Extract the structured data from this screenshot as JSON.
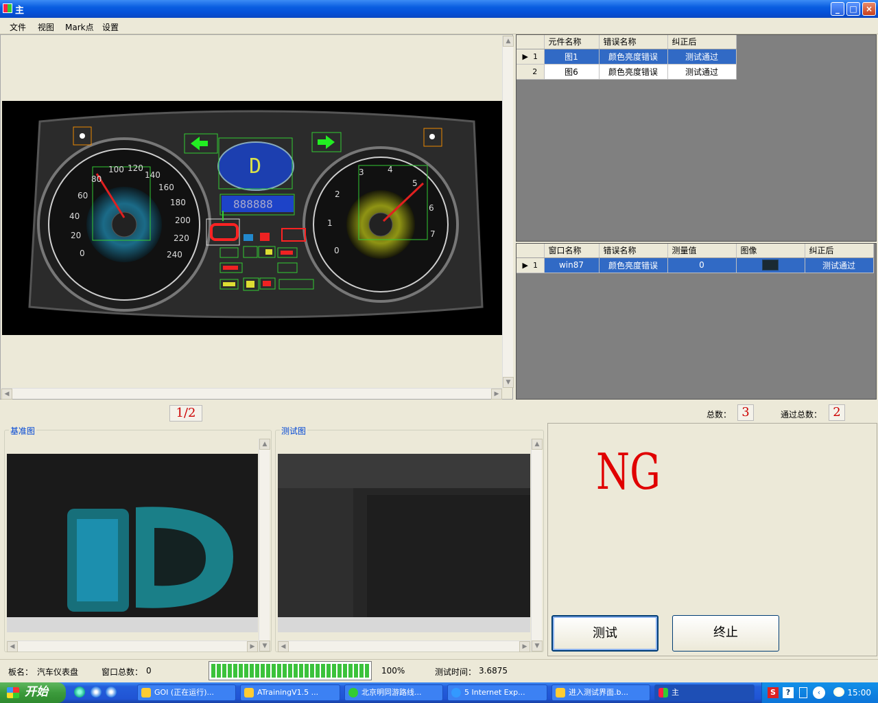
{
  "window": {
    "title": "主"
  },
  "menu": [
    "文件",
    "视图",
    "Mark点",
    "设置"
  ],
  "components_grid": {
    "columns": [
      "元件名称",
      "错误名称",
      "纠正后"
    ],
    "rows": [
      {
        "index": "1",
        "name": "图1",
        "error": "颜色亮度错误",
        "corrected": "测试通过"
      },
      {
        "index": "2",
        "name": "图6",
        "error": "颜色亮度错误",
        "corrected": "测试通过"
      }
    ]
  },
  "windows_grid": {
    "columns": [
      "窗口名称",
      "错误名称",
      "测量值",
      "图像",
      "纠正后"
    ],
    "rows": [
      {
        "index": "1",
        "name": "win87",
        "error": "颜色亮度错误",
        "value": "0",
        "corrected": "测试通过"
      }
    ]
  },
  "pager": "1/2",
  "totals": {
    "total_label": "总数：",
    "total_value": "3",
    "passed_label": "通过总数：",
    "passed_value": "2"
  },
  "reference_label": "基准图",
  "test_label": "测试图",
  "result": {
    "text": "NG",
    "color": "#e00000"
  },
  "buttons": {
    "test": "测试",
    "stop": "终止"
  },
  "status": {
    "board_label": "板名：",
    "board_value": "汽车仪表盘",
    "windows_label": "窗口总数：",
    "windows_value": "0",
    "progress_text": "100%",
    "progress": 1.0,
    "time_label": "测试时间：",
    "time_value": "3.6875"
  },
  "taskbar": {
    "start": "开始",
    "tasks": [
      "GOI (正在运行)...",
      "ATrainingV1.5 ...",
      "北京明同游路线...",
      "5 Internet Exp...",
      "进入测试界面.b...",
      "主"
    ],
    "clock": "15:00"
  }
}
